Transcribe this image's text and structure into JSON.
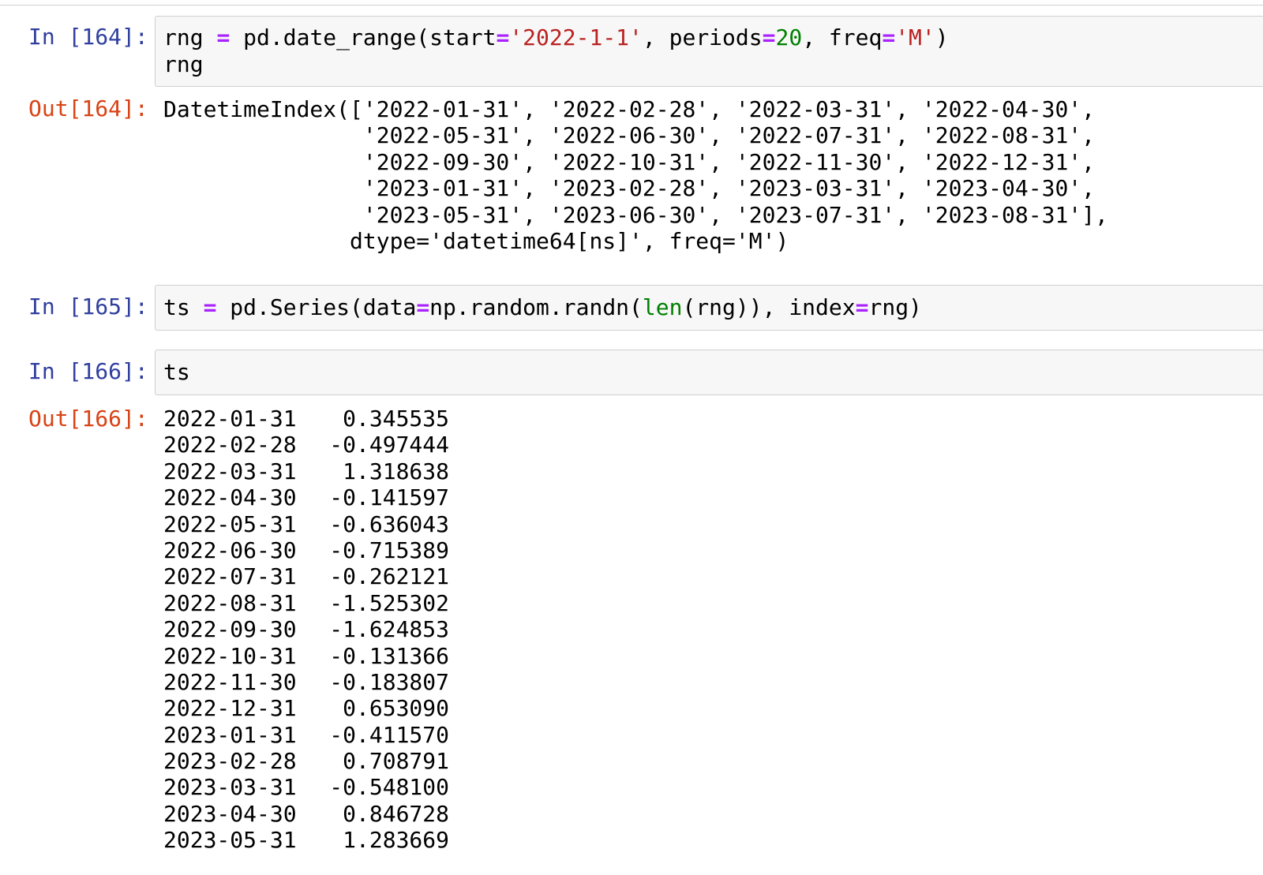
{
  "cells": {
    "c164": {
      "in_prompt": "In [164]:",
      "out_prompt": "Out[164]:",
      "code_line1": {
        "p1": "rng ",
        "p2": "=",
        "p3": " pd.date_range(start",
        "p4": "=",
        "p5": "'2022-1-1'",
        "p6": ", periods",
        "p7": "=",
        "p8": "20",
        "p9": ", freq",
        "p10": "=",
        "p11": "'M'",
        "p12": ")"
      },
      "code_line2": "rng",
      "output_lines": [
        "DatetimeIndex(['2022-01-31', '2022-02-28', '2022-03-31', '2022-04-30',",
        "               '2022-05-31', '2022-06-30', '2022-07-31', '2022-08-31',",
        "               '2022-09-30', '2022-10-31', '2022-11-30', '2022-12-31',",
        "               '2023-01-31', '2023-02-28', '2023-03-31', '2023-04-30',",
        "               '2023-05-31', '2023-06-30', '2023-07-31', '2023-08-31'],",
        "              dtype='datetime64[ns]', freq='M')"
      ]
    },
    "c165": {
      "in_prompt": "In [165]:",
      "code": {
        "p1": "ts ",
        "p2": "=",
        "p3": " pd.Series(data",
        "p4": "=",
        "p5": "np.random.randn(",
        "p6": "len",
        "p7": "(rng)), index",
        "p8": "=",
        "p9": "rng)"
      }
    },
    "c166": {
      "in_prompt": "In [166]:",
      "out_prompt": "Out[166]:",
      "code": "ts",
      "series": [
        {
          "date": "2022-01-31",
          "value": "0.345535"
        },
        {
          "date": "2022-02-28",
          "value": "-0.497444"
        },
        {
          "date": "2022-03-31",
          "value": "1.318638"
        },
        {
          "date": "2022-04-30",
          "value": "-0.141597"
        },
        {
          "date": "2022-05-31",
          "value": "-0.636043"
        },
        {
          "date": "2022-06-30",
          "value": "-0.715389"
        },
        {
          "date": "2022-07-31",
          "value": "-0.262121"
        },
        {
          "date": "2022-08-31",
          "value": "-1.525302"
        },
        {
          "date": "2022-09-30",
          "value": "-1.624853"
        },
        {
          "date": "2022-10-31",
          "value": "-0.131366"
        },
        {
          "date": "2022-11-30",
          "value": "-0.183807"
        },
        {
          "date": "2022-12-31",
          "value": "0.653090"
        },
        {
          "date": "2023-01-31",
          "value": "-0.411570"
        },
        {
          "date": "2023-02-28",
          "value": "0.708791"
        },
        {
          "date": "2023-03-31",
          "value": "-0.548100"
        },
        {
          "date": "2023-04-30",
          "value": "0.846728"
        },
        {
          "date": "2023-05-31",
          "value": "1.283669"
        }
      ]
    }
  },
  "colors": {
    "prompt_in": "#303f9f",
    "prompt_out": "#d84315",
    "operator": "#aa22ff",
    "string": "#ba2121",
    "number": "#008000",
    "builtin": "#008000",
    "input_bg": "#f7f7f7",
    "input_border": "#cfcfcf"
  }
}
